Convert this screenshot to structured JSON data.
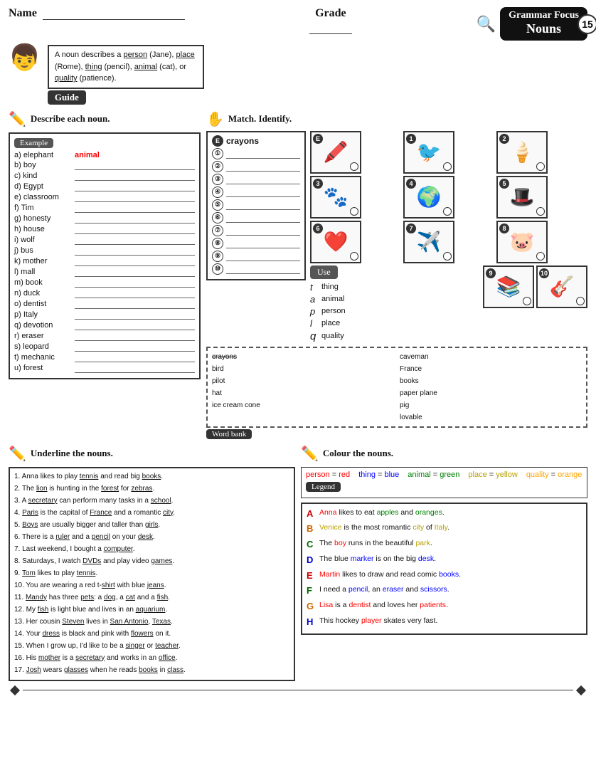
{
  "header": {
    "name_label": "Name",
    "grade_label": "Grade",
    "grammar_focus": "Grammar Focus",
    "nouns": "Nouns",
    "number": "15"
  },
  "guide": {
    "text": "A noun describes a person (Jane), place (Rome), thing (pencil), animal (cat), or quality (patience).",
    "badge": "Guide"
  },
  "section1": {
    "title": "Describe each noun.",
    "example_label": "Example",
    "example_word": "a) elephant",
    "example_answer": "animal",
    "items": [
      "b) boy",
      "c) kind",
      "d) Egypt",
      "e) classroom",
      "f) Tim",
      "g) honesty",
      "h) house",
      "i) wolf",
      "j) bus",
      "k) mother",
      "l) mall",
      "m) book",
      "n) duck",
      "o) dentist",
      "p) Italy",
      "q) devotion",
      "r) eraser",
      "s) leopard",
      "t) mechanic",
      "u) forest"
    ]
  },
  "section2": {
    "title": "Match. Identify.",
    "header_word": "crayons",
    "list_items": [
      "①",
      "②",
      "③",
      "④",
      "⑤",
      "⑥",
      "⑦",
      "⑧",
      "⑨",
      "⑩"
    ],
    "images": [
      {
        "num": "E",
        "emoji": "🖍️"
      },
      {
        "num": "1",
        "emoji": "🐦"
      },
      {
        "num": "2",
        "emoji": "🍦"
      },
      {
        "num": "3",
        "emoji": "🐾"
      },
      {
        "num": "4",
        "emoji": "🌍"
      },
      {
        "num": "5",
        "emoji": "🎩"
      },
      {
        "num": "6",
        "emoji": "❤️"
      },
      {
        "num": "7",
        "emoji": "✈️"
      },
      {
        "num": "8",
        "emoji": "🐷"
      },
      {
        "num": "9",
        "emoji": "📚"
      },
      {
        "num": "10",
        "emoji": "🎸"
      }
    ],
    "word_bank_col1": [
      "crayons",
      "bird",
      "pilot",
      "hat",
      "ice cream cone"
    ],
    "word_bank_col2": [
      "caveman",
      "France",
      "books",
      "paper plane",
      "pig",
      "lovable"
    ],
    "word_bank_badge": "Word bank",
    "use_badge": "Use",
    "use_items": [
      {
        "letter": "t",
        "word": "thing"
      },
      {
        "letter": "a",
        "word": "animal"
      },
      {
        "letter": "p",
        "word": "person"
      },
      {
        "letter": "l",
        "word": "place"
      },
      {
        "letter": "q",
        "word": "quality"
      }
    ]
  },
  "section3": {
    "title": "Underline the nouns.",
    "sentences": [
      "1. Anna likes to play tennis and read big books.",
      "2. The lion is hunting in the forest for zebras.",
      "3. A secretary can perform many tasks in a school.",
      "4. Paris is the capital of France and a romantic city.",
      "5. Boys are usually bigger and taller than girls.",
      "6. There is a ruler and a pencil on your desk.",
      "7. Last weekend, I bought a computer.",
      "8. Saturdays, I watch DVDs and play video games.",
      "9. Tom likes to play tennis.",
      "10. You are wearing a red t-shirt with blue jeans.",
      "11. Mandy has three pets: a dog, a cat and a fish.",
      "12. My fish is light blue and lives in an aquarium.",
      "13. Her cousin Steven lives in San Antonio, Texas.",
      "14. Your dress is black and pink with flowers on it.",
      "15. When I grow up, I'd like to be a singer or teacher.",
      "16. His mother is a secretary and works in an office.",
      "17. Josh wears glasses when he reads books in class."
    ]
  },
  "section4": {
    "title": "Colour the nouns.",
    "legend_items": [
      {
        "label": "person = red",
        "color": "red"
      },
      {
        "label": "thing = blue",
        "color": "blue"
      },
      {
        "label": "animal = green",
        "color": "green"
      },
      {
        "label": "place = yellow",
        "color": "#b8a000"
      },
      {
        "label": "quality = orange",
        "color": "orange"
      }
    ],
    "legend_badge": "Legend",
    "sentences": [
      {
        "letter": "A",
        "text": "Anna likes to eat apples and oranges.",
        "class": "cs-a"
      },
      {
        "letter": "B",
        "text": "Venice is the most romantic city of Italy.",
        "class": "cs-b"
      },
      {
        "letter": "C",
        "text": "The boy runs in the beautiful park.",
        "class": "cs-c"
      },
      {
        "letter": "D",
        "text": "The blue marker is on the big desk.",
        "class": "cs-d"
      },
      {
        "letter": "E",
        "text": "Martin likes to draw and read comic books.",
        "class": "cs-e"
      },
      {
        "letter": "F",
        "text": "I need a pencil, an eraser and scissors.",
        "class": "cs-f"
      },
      {
        "letter": "G",
        "text": "Lisa is a dentist and loves her patients.",
        "class": "cs-g"
      },
      {
        "letter": "H",
        "text": "This hockey player skates very fast.",
        "class": "cs-h"
      }
    ]
  }
}
